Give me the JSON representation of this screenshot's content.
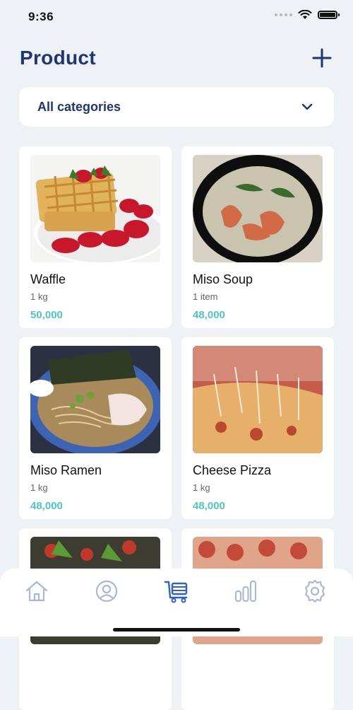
{
  "status": {
    "time": "9:36"
  },
  "header": {
    "title": "Product",
    "add_icon": "plus-icon"
  },
  "filter": {
    "selected": "All categories",
    "icon": "chevron-down-icon"
  },
  "products": [
    {
      "name": "Waffle",
      "unit": "1 kg",
      "price": "50,000"
    },
    {
      "name": "Miso Soup",
      "unit": "1 item",
      "price": "48,000"
    },
    {
      "name": "Miso Ramen",
      "unit": "1 kg",
      "price": "48,000"
    },
    {
      "name": "Cheese Pizza",
      "unit": "1 kg",
      "price": "48,000"
    },
    {
      "name": "",
      "unit": "",
      "price": ""
    },
    {
      "name": "",
      "unit": "",
      "price": ""
    }
  ],
  "nav": {
    "items": [
      {
        "icon": "home-icon",
        "active": false
      },
      {
        "icon": "user-icon",
        "active": false
      },
      {
        "icon": "cart-icon",
        "active": true
      },
      {
        "icon": "stats-icon",
        "active": false
      },
      {
        "icon": "settings-icon",
        "active": false
      }
    ]
  },
  "colors": {
    "background": "#eef1f6",
    "title": "#1f3575",
    "price": "#4fc8c1",
    "nav_active": "#2f62c9",
    "nav_inactive": "#a9b8d6"
  }
}
